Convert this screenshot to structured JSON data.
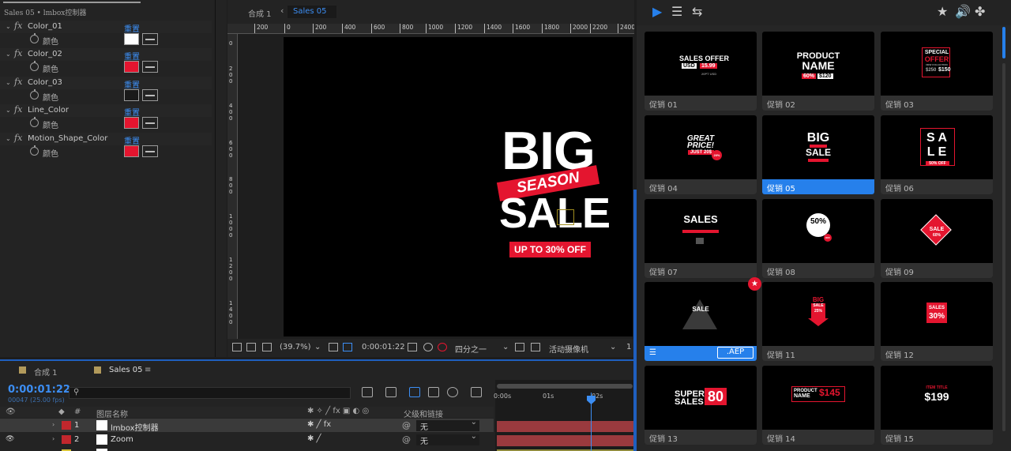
{
  "effect_controls": {
    "title": "Sales 05 • lmbox控制器",
    "reset_label": "重置",
    "color_label": "颜色",
    "params": [
      {
        "name": "Color_01",
        "color": "#ffffff"
      },
      {
        "name": "Color_02",
        "color": "#e4152f"
      },
      {
        "name": "Color_03",
        "color": "#1a1a1a"
      },
      {
        "name": "Line_Color",
        "color": "#e4152f"
      },
      {
        "name": "Motion_Shape_Color",
        "color": "#e4152f"
      }
    ]
  },
  "viewer": {
    "tab_comp1": "合成 1",
    "tab_sales": "Sales 05",
    "ruler_ticks": [
      "200",
      "0",
      "200",
      "400",
      "600",
      "800",
      "1000",
      "1200",
      "1400",
      "1600",
      "1800",
      "2000",
      "2200",
      "2400"
    ],
    "left_ruler_ticks": [
      "0",
      "2 0 0",
      "4 0 0",
      "6 0 0",
      "8 0 0",
      "1 0 0 0",
      "1 2 0 0",
      "1 4 0 0"
    ],
    "canvas": {
      "big": "BIG",
      "season": "SEASON",
      "sale": "SALE",
      "offer": "UP TO 30% OFF"
    },
    "bottom_bar": {
      "zoom": "(39.7%)",
      "timecode": "0:00:01:22",
      "resolution": "四分之一",
      "camera": "活动摄像机",
      "views": "1"
    }
  },
  "timeline": {
    "tab_comp1": "合成 1",
    "tab_sales": "Sales 05",
    "timecode": "0:00:01:22",
    "fps": "00047 (25.00 fps)",
    "search_glyph": "⚲",
    "col_name": "图层名称",
    "col_parent": "父级和链接",
    "col_hash": "#",
    "ruler": [
      "0:00s",
      "01s",
      "02s"
    ],
    "layers": [
      {
        "num": "1",
        "name": "lmbox控制器",
        "parent": "无",
        "label_color": "#c1272d"
      },
      {
        "num": "2",
        "name": "Zoom",
        "parent": "无",
        "label_color": "#c1272d"
      }
    ]
  },
  "library": {
    "items": [
      {
        "label": "促销 01",
        "selected": false
      },
      {
        "label": "促销 02",
        "selected": false
      },
      {
        "label": "促销 03",
        "selected": false
      },
      {
        "label": "促销 04",
        "selected": false
      },
      {
        "label": "促销 05",
        "selected": true
      },
      {
        "label": "促销 06",
        "selected": false
      },
      {
        "label": "促销 07",
        "selected": false
      },
      {
        "label": "促销 08",
        "selected": false
      },
      {
        "label": "促销 09",
        "selected": false
      },
      {
        "label": ".AEP",
        "selected": true
      },
      {
        "label": "促销 11",
        "selected": false
      },
      {
        "label": "促销 12",
        "selected": false
      },
      {
        "label": "促销 13",
        "selected": false
      },
      {
        "label": "促销 14",
        "selected": false
      },
      {
        "label": "促销 15",
        "selected": false
      }
    ],
    "thumbs": {
      "t1": {
        "a": "SALES OFFER",
        "b": "USD",
        "c": "15.99",
        "d": "20PT USD"
      },
      "t2": {
        "a": "PRODUCT",
        "b": "NAME",
        "c": "60%",
        "d": "$120"
      },
      "t3": {
        "a": "SPECIAL",
        "b": "OFFER",
        "c": "NEW COLLECTION",
        "d": "$250",
        "e": "$150"
      },
      "t4": {
        "a": "GREAT",
        "b": "PRICE!",
        "c": "JUST 20$",
        "d": "20%"
      },
      "t5": {
        "a": "BIG",
        "b": "SALE"
      },
      "t6": {
        "a": "S A",
        "b": "L E",
        "c": "50% OFF"
      },
      "t7": {
        "a": "SALES"
      },
      "t8": {
        "a": "50%",
        "b": "OFF"
      },
      "t9": {
        "a": "SALE",
        "b": "60%"
      },
      "t10": {
        "a": "SALE"
      },
      "t11": {
        "a": "BIG",
        "b": "SALE",
        "c": "25%"
      },
      "t12": {
        "a": "SALES",
        "b": "30%"
      },
      "t13": {
        "a": "SUPER",
        "b": "SALES",
        "c": "80"
      },
      "t14": {
        "a": "PRODUCT",
        "b": "NAME",
        "c": "$145"
      },
      "t15": {
        "a": "ITEM TITLE",
        "b": "$199"
      }
    }
  }
}
